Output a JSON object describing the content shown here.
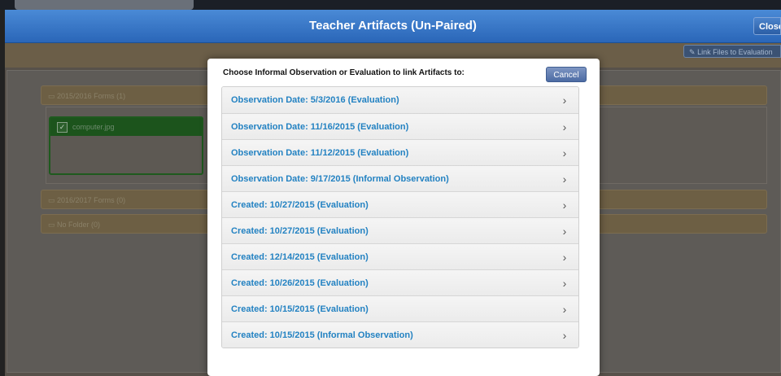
{
  "header": {
    "title": "Teacher Artifacts (Un-Paired)",
    "close_label": "Close"
  },
  "background": {
    "link_files_label": "Link Files to Evaluation",
    "folders": [
      {
        "label": "2015/2016 Forms (1)"
      },
      {
        "label": "2016/2017 Forms (0)"
      },
      {
        "label": "No Folder (0)"
      }
    ],
    "file_name": "computer.jpg"
  },
  "modal": {
    "prompt": "Choose Informal Observation or Evaluation to link Artifacts to:",
    "cancel_label": "Cancel",
    "items": [
      {
        "label": "Observation Date: 5/3/2016 (Evaluation)"
      },
      {
        "label": "Observation Date: 11/16/2015 (Evaluation)"
      },
      {
        "label": "Observation Date: 11/12/2015 (Evaluation)"
      },
      {
        "label": "Observation Date: 9/17/2015 (Informal Observation)"
      },
      {
        "label": "Created: 10/27/2015 (Evaluation)"
      },
      {
        "label": "Created: 10/27/2015 (Evaluation)"
      },
      {
        "label": "Created: 12/14/2015 (Evaluation)"
      },
      {
        "label": "Created: 10/26/2015 (Evaluation)"
      },
      {
        "label": "Created: 10/15/2015 (Evaluation)"
      },
      {
        "label": "Created: 10/15/2015 (Informal Observation)"
      }
    ]
  },
  "colors": {
    "header": "#3b78c8",
    "link": "#2382c2",
    "cancel": "#5d7ab0",
    "file_selected": "#1c541c"
  },
  "icons": {
    "folder": "folder-icon",
    "chevron": "chevron-right-icon",
    "checkbox": "checkbox-checked-icon",
    "link": "link-icon"
  }
}
